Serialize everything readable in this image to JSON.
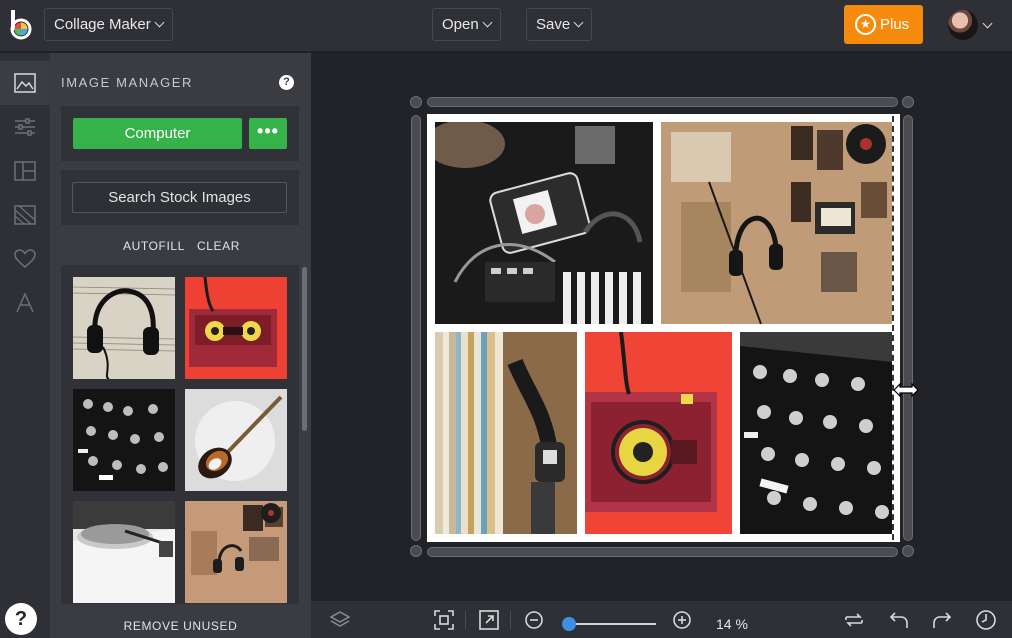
{
  "header": {
    "app_menu_label": "Collage Maker",
    "open_label": "Open",
    "save_label": "Save",
    "plus_label": "Plus"
  },
  "sidebar_rail": {
    "items": [
      "image-manager",
      "adjust",
      "layouts",
      "backgrounds",
      "graphics",
      "text"
    ]
  },
  "image_manager": {
    "title": "IMAGE MANAGER",
    "help": "?",
    "computer_label": "Computer",
    "more_label": "•••",
    "search_label": "Search Stock Images",
    "autofill_label": "AUTOFILL",
    "clear_label": "CLEAR",
    "remove_unused_label": "REMOVE UNUSED",
    "thumbnails": [
      "headphones-sheet-music",
      "cassette-on-red",
      "dj-mixer",
      "electric-guitar",
      "turntable",
      "bedroom-wall-headphones"
    ]
  },
  "bottom_bar": {
    "zoom_percent": "14 %",
    "zoom_level": 0.14
  },
  "help_button": "?",
  "colors": {
    "accent_orange": "#f48b0c",
    "accent_green": "#35b24a",
    "zoom_blue": "#3d8fe0"
  }
}
